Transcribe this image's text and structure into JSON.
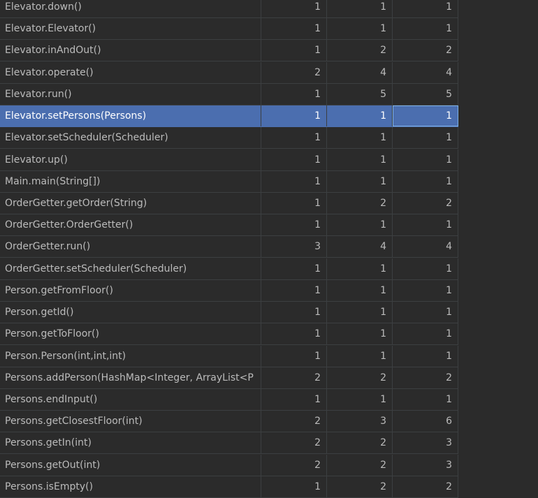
{
  "rows": [
    {
      "name": "Elevator.down()",
      "v1": "1",
      "v2": "1",
      "v3": "1"
    },
    {
      "name": "Elevator.Elevator()",
      "v1": "1",
      "v2": "1",
      "v3": "1"
    },
    {
      "name": "Elevator.inAndOut()",
      "v1": "1",
      "v2": "2",
      "v3": "2"
    },
    {
      "name": "Elevator.operate()",
      "v1": "2",
      "v2": "4",
      "v3": "4"
    },
    {
      "name": "Elevator.run()",
      "v1": "1",
      "v2": "5",
      "v3": "5"
    },
    {
      "name": "Elevator.setPersons(Persons)",
      "v1": "1",
      "v2": "1",
      "v3": "1"
    },
    {
      "name": "Elevator.setScheduler(Scheduler)",
      "v1": "1",
      "v2": "1",
      "v3": "1"
    },
    {
      "name": "Elevator.up()",
      "v1": "1",
      "v2": "1",
      "v3": "1"
    },
    {
      "name": "Main.main(String[])",
      "v1": "1",
      "v2": "1",
      "v3": "1"
    },
    {
      "name": "OrderGetter.getOrder(String)",
      "v1": "1",
      "v2": "2",
      "v3": "2"
    },
    {
      "name": "OrderGetter.OrderGetter()",
      "v1": "1",
      "v2": "1",
      "v3": "1"
    },
    {
      "name": "OrderGetter.run()",
      "v1": "3",
      "v2": "4",
      "v3": "4"
    },
    {
      "name": "OrderGetter.setScheduler(Scheduler)",
      "v1": "1",
      "v2": "1",
      "v3": "1"
    },
    {
      "name": "Person.getFromFloor()",
      "v1": "1",
      "v2": "1",
      "v3": "1"
    },
    {
      "name": "Person.getId()",
      "v1": "1",
      "v2": "1",
      "v3": "1"
    },
    {
      "name": "Person.getToFloor()",
      "v1": "1",
      "v2": "1",
      "v3": "1"
    },
    {
      "name": "Person.Person(int,int,int)",
      "v1": "1",
      "v2": "1",
      "v3": "1"
    },
    {
      "name": "Persons.addPerson(HashMap<Integer, ArrayList<P",
      "v1": "2",
      "v2": "2",
      "v3": "2"
    },
    {
      "name": "Persons.endInput()",
      "v1": "1",
      "v2": "1",
      "v3": "1"
    },
    {
      "name": "Persons.getClosestFloor(int)",
      "v1": "2",
      "v2": "3",
      "v3": "6"
    },
    {
      "name": "Persons.getIn(int)",
      "v1": "2",
      "v2": "2",
      "v3": "3"
    },
    {
      "name": "Persons.getOut(int)",
      "v1": "2",
      "v2": "2",
      "v3": "3"
    },
    {
      "name": "Persons.isEmpty()",
      "v1": "1",
      "v2": "2",
      "v3": "2"
    }
  ],
  "selected_row": 5,
  "colors": {
    "background": "#2b2b2b",
    "text": "#bbbbbb",
    "grid": "#3c3f41",
    "selection": "#4b6eaf"
  }
}
